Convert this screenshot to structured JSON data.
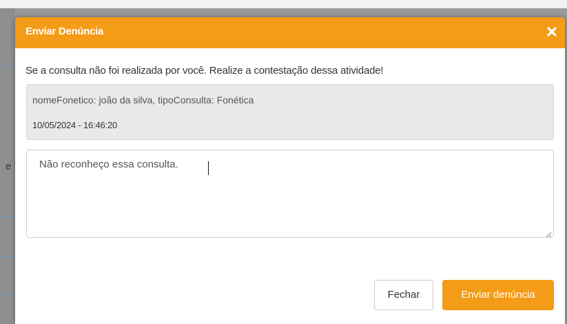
{
  "modal": {
    "title": "Enviar Denúncia",
    "close_icon": "close-icon",
    "instruction": "Se a consulta não foi realizada por você. Realize a contestação dessa atividade!",
    "info": {
      "description": "nomeFonetico: joão da silva, tipoConsulta: Fonética",
      "datetime": "10/05/2024 - 16:46:20"
    },
    "textarea": {
      "value": "Não reconheço essa consulta."
    },
    "buttons": {
      "close_label": "Fechar",
      "submit_label": "Enviar denúncia"
    }
  },
  "background": {
    "partial_letter": "e"
  },
  "colors": {
    "accent": "#f49b17",
    "header_text": "#ffffff",
    "info_box": "#e9e9e9"
  }
}
